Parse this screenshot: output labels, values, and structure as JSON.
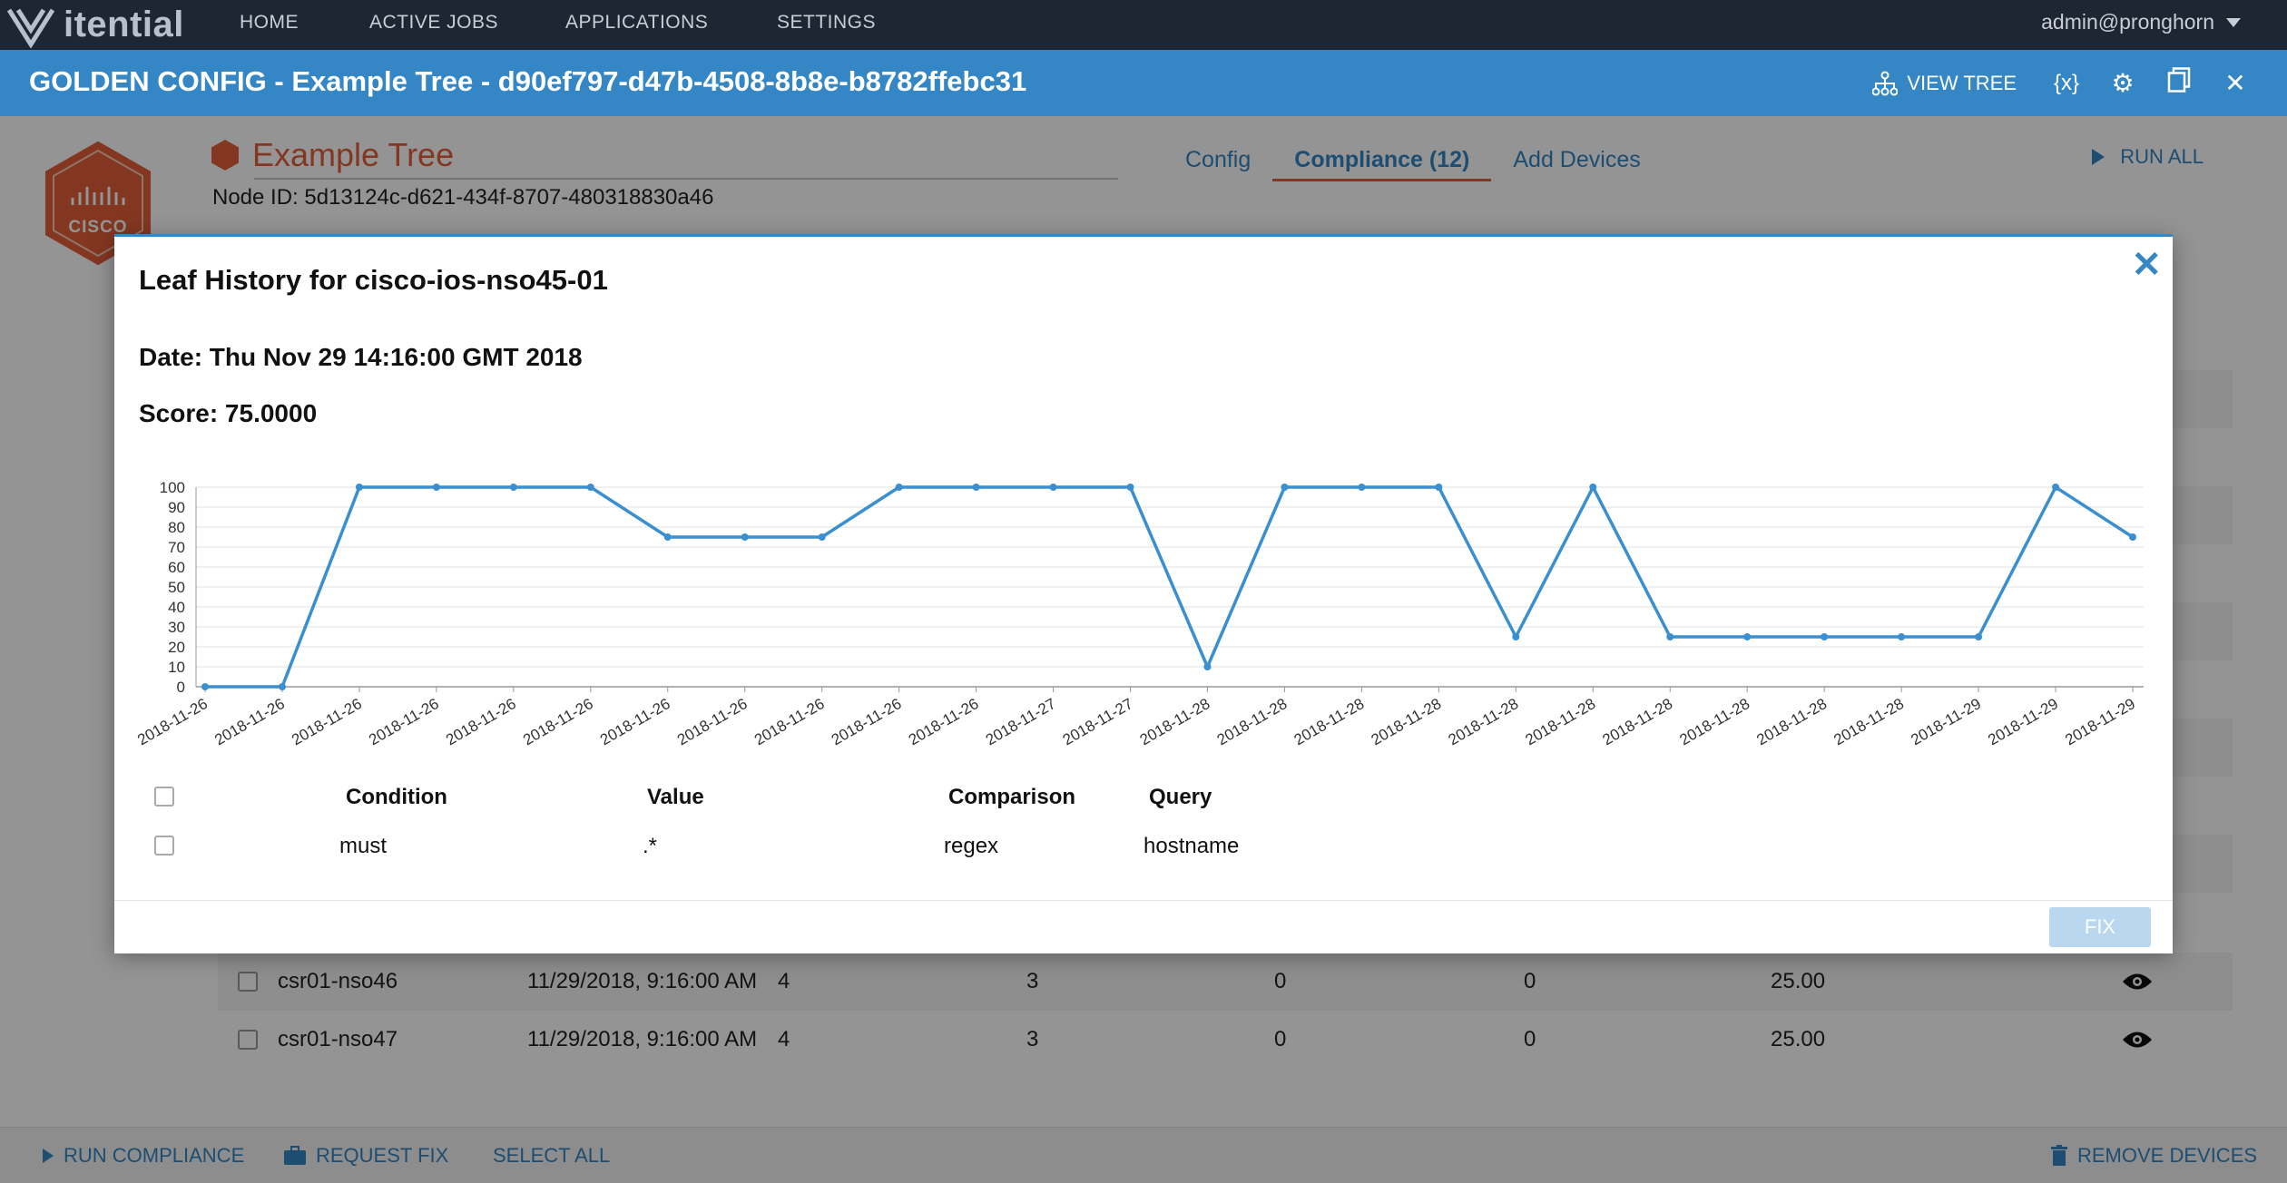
{
  "nav": {
    "brand": "itential",
    "items": [
      "HOME",
      "ACTIVE JOBS",
      "APPLICATIONS",
      "SETTINGS"
    ],
    "user": "admin@pronghorn"
  },
  "titlebar": {
    "title": "GOLDEN CONFIG - Example Tree - d90ef797-d47b-4508-8b8e-b8782ffebc31",
    "view_tree": "VIEW TREE",
    "variables_icon": "{x}"
  },
  "node": {
    "badge_text": "CISCO",
    "name": "Example Tree",
    "node_id": "Node ID: 5d13124c-d621-434f-8707-480318830a46",
    "tabs": [
      "Config",
      "Compliance (12)",
      "Add Devices"
    ],
    "run_all": "RUN ALL"
  },
  "devices": [
    {
      "name": "csr01-nso46",
      "date": "11/29/2018, 9:16:00 AM",
      "c1": "4",
      "c2": "3",
      "c3": "0",
      "c4": "0",
      "score": "25.00"
    },
    {
      "name": "csr01-nso47",
      "date": "11/29/2018, 9:16:00 AM",
      "c1": "4",
      "c2": "3",
      "c3": "0",
      "c4": "0",
      "score": "25.00"
    }
  ],
  "bottombar": {
    "run_compliance": "RUN COMPLIANCE",
    "request_fix": "REQUEST FIX",
    "select_all": "SELECT ALL",
    "remove_devices": "REMOVE DEVICES"
  },
  "modal": {
    "title": "Leaf History for cisco-ios-nso45-01",
    "date": "Date: Thu Nov 29 14:16:00 GMT 2018",
    "score": "Score: 75.0000",
    "fix": "FIX",
    "table": {
      "headers": [
        "Condition",
        "Value",
        "Comparison",
        "Query"
      ],
      "rows": [
        {
          "condition": "must",
          "value": ".*",
          "comparison": "regex",
          "query": "hostname"
        }
      ]
    }
  },
  "chart_data": {
    "type": "line",
    "x": [
      "2018-11-26",
      "2018-11-26",
      "2018-11-26",
      "2018-11-26",
      "2018-11-26",
      "2018-11-26",
      "2018-11-26",
      "2018-11-26",
      "2018-11-26",
      "2018-11-26",
      "2018-11-26",
      "2018-11-27",
      "2018-11-27",
      "2018-11-28",
      "2018-11-28",
      "2018-11-28",
      "2018-11-28",
      "2018-11-28",
      "2018-11-28",
      "2018-11-28",
      "2018-11-28",
      "2018-11-28",
      "2018-11-28",
      "2018-11-29",
      "2018-11-29",
      "2018-11-29"
    ],
    "values": [
      0,
      0,
      100,
      100,
      100,
      100,
      75,
      75,
      75,
      100,
      100,
      100,
      100,
      10,
      100,
      100,
      100,
      25,
      100,
      25,
      25,
      25,
      25,
      25,
      100,
      75
    ],
    "ylim": [
      0,
      100
    ],
    "yticks": [
      0,
      10,
      20,
      30,
      40,
      50,
      60,
      70,
      80,
      90,
      100
    ],
    "grid": true,
    "color": "#3a8fd0"
  }
}
